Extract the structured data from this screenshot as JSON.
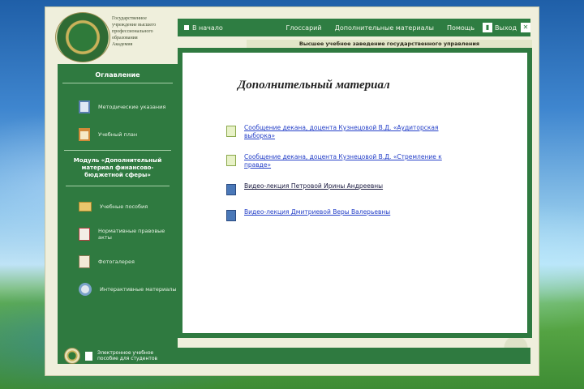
{
  "header": {
    "emblem_title_lines": [
      "Государственное",
      "учреждение высшего",
      "профессионального",
      "образования",
      "Академия"
    ],
    "subtitle": "Высшее учебное заведение государственного управления"
  },
  "topnav": {
    "home": "В начало",
    "glossary": "Глоссарий",
    "materials": "Дополнительные материалы",
    "help": "Помощь",
    "exit": "Выход"
  },
  "sidebar": {
    "heading": "Оглавление",
    "items": [
      {
        "icon": "book-icon",
        "label": "Методические указания"
      },
      {
        "icon": "calendar-icon",
        "label": "Учебный план"
      }
    ],
    "block_title": "Модуль «Дополнительный материал финансово-бюджетной сферы»",
    "sections": [
      {
        "icon": "folder-icon",
        "label": "Учебные пособия"
      },
      {
        "icon": "document-icon",
        "label": "Нормативные правовые акты"
      },
      {
        "icon": "gallery-icon",
        "label": "Фотогалерея"
      },
      {
        "icon": "gear-icon",
        "label": "Интерактивные материалы"
      }
    ]
  },
  "main": {
    "title": "Дополнительный материал",
    "links": [
      {
        "icon": "certificate-icon",
        "text": "Сообщение декана, доцента Кузнецовой В.Д. «Аудиторская выборка»",
        "style": "link"
      },
      {
        "icon": "certificate-icon",
        "text": "Сообщение декана, доцента Кузнецовой В.Д. «Стремление к правде»",
        "style": "link"
      },
      {
        "icon": "file-icon",
        "text": "Видео-лекция Петровой Ирины Андреевны",
        "style": "dark"
      },
      {
        "icon": "file-icon",
        "text": "Видео-лекция Дмитриевой Веры Валерьевны",
        "style": "link"
      }
    ]
  },
  "footer": {
    "text_line1": "Электронное учебное",
    "text_line2": "пособие для студентов"
  },
  "colors": {
    "panel_green": "#2f7a40",
    "background_cream": "#efefdc",
    "link_blue": "#2540c8"
  }
}
